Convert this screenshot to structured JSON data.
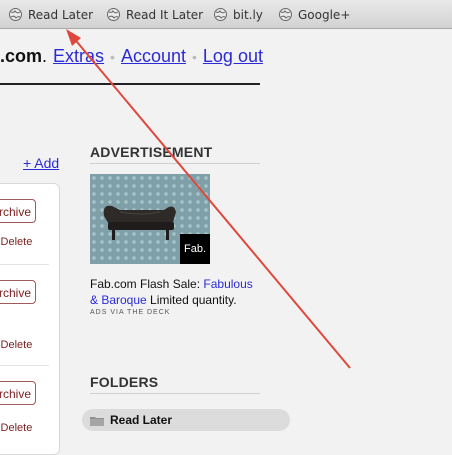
{
  "bookmarks": [
    {
      "label": "Read Later",
      "icon": "globe-icon"
    },
    {
      "label": "Read It Later",
      "icon": "globe-icon"
    },
    {
      "label": "bit.ly",
      "icon": "globe-icon"
    },
    {
      "label": "Google+",
      "icon": "globe-icon"
    }
  ],
  "nav": {
    "site_partial": ".com",
    "site_dot": ".",
    "extras": "Extras",
    "account": "Account",
    "logout": "Log out",
    "separator": "•"
  },
  "list": {
    "add_link": "+ Add",
    "rows": [
      {
        "archive": "Archive",
        "delete": "Delete",
        "dot": "•"
      },
      {
        "archive": "Archive",
        "delete": "Delete",
        "dot": "•"
      },
      {
        "archive": "Archive",
        "delete": "Delete",
        "dot": "•"
      }
    ]
  },
  "sidebar": {
    "ad_title": "ADVERTISEMENT",
    "ad_badge": "Fab.",
    "ad_text_prefix": "Fab.com Flash Sale: ",
    "ad_link": "Fabulous & Baroque",
    "ad_text_suffix": " Limited quantity.",
    "ad_credit": "ADS VIA THE DECK",
    "folders_title": "FOLDERS",
    "folders": [
      {
        "label": "Read Later",
        "icon": "folder-icon"
      }
    ]
  },
  "colors": {
    "link": "#2b2bd6",
    "archive_text": "#7a1f1f",
    "annotation_arrow": "#e0473c"
  }
}
